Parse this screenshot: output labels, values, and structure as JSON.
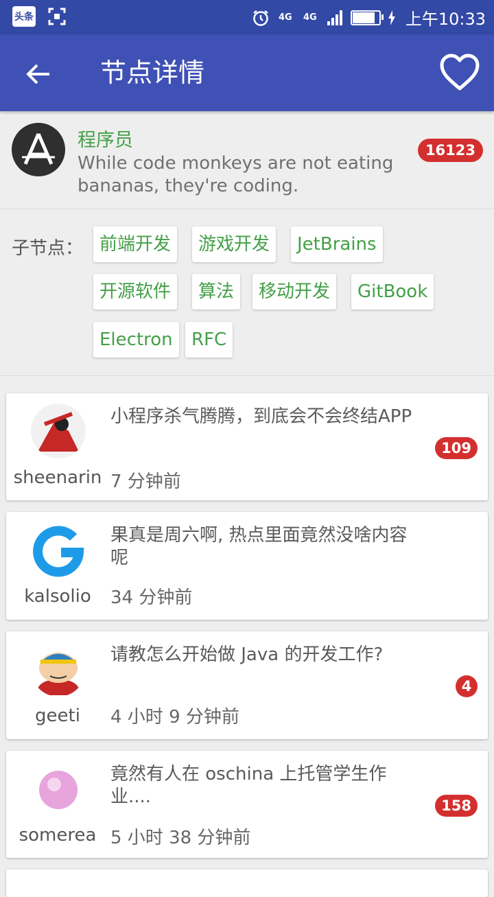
{
  "status_bar": {
    "app_icon_text": "头条",
    "net1": "4G",
    "net2": "4G",
    "time": "上午10:33"
  },
  "app_bar": {
    "title": "节点详情"
  },
  "node": {
    "name": "程序员",
    "description": "While code monkeys are not eating bananas, they're coding.",
    "topic_count": "16123"
  },
  "sub_nodes": {
    "label": "子节点：",
    "items": [
      "前端开发",
      "游戏开发",
      "JetBrains",
      "开源软件",
      "算法",
      "移动开发",
      "GitBook",
      "Electron",
      "RFC"
    ]
  },
  "topics": [
    {
      "username": "sheenarin",
      "title": "小程序杀气腾腾，到底会不会终结APP",
      "time": "7 分钟前",
      "replies": "109"
    },
    {
      "username": "kalsolio",
      "title": "果真是周六啊, 热点里面竟然没啥内容呢",
      "time": "34 分钟前",
      "replies": ""
    },
    {
      "username": "geeti",
      "title": "请教怎么开始做 Java 的开发工作?",
      "time": "4 小时 9 分钟前",
      "replies": "4"
    },
    {
      "username": "somerea",
      "title": "竟然有人在 oschina 上托管学生作业....",
      "time": "5 小时 38 分钟前",
      "replies": "158"
    }
  ],
  "colors": {
    "primary": "#3f51b5",
    "status_bar": "#3349a6",
    "accent_green": "#43a047",
    "badge_red": "#d32f2f"
  }
}
